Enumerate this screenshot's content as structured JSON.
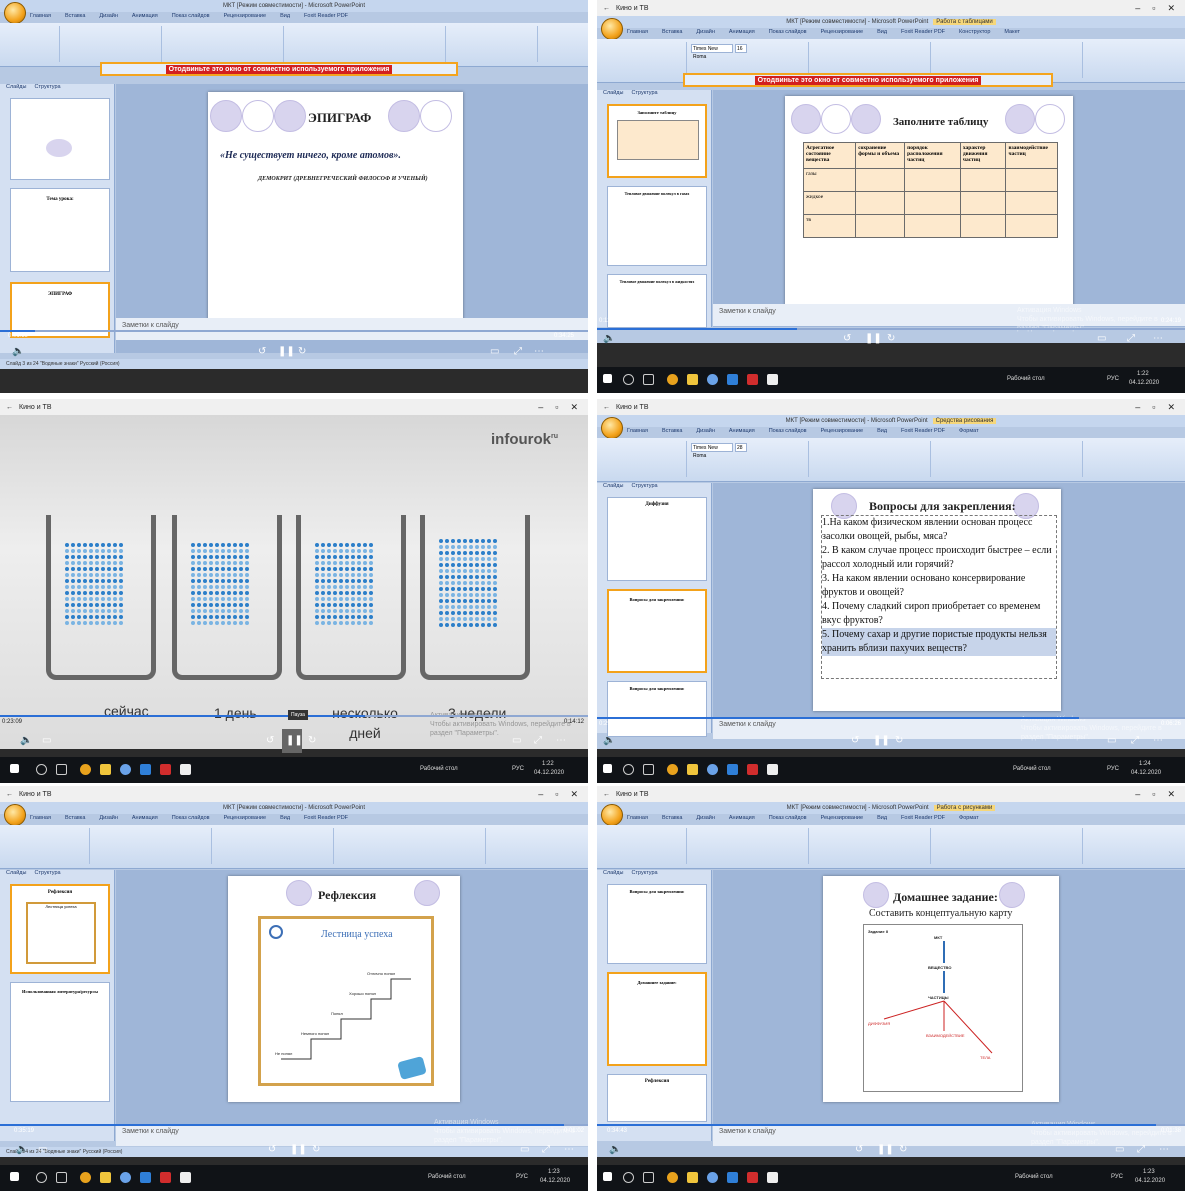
{
  "panels": {
    "p1": {
      "window_title": "МКТ [Режим совместимости] - Microsoft PowerPoint",
      "ribbon_tabs": [
        "Главная",
        "Вставка",
        "Дизайн",
        "Анимация",
        "Показ слайдов",
        "Рецензирование",
        "Вид",
        "Foxit Reader PDF"
      ],
      "warning": "Отодвиньте это окно от совместно используемого приложения",
      "pane_tabs": [
        "Слайды",
        "Структура"
      ],
      "thumb2_title": "Тема урока:",
      "thumb3_title": "ЭПИГРАФ",
      "slide_title": "ЭПИГРАФ",
      "quote": "«Не существует ничего, кроме атомов».",
      "author": "ДЕМОКРИТ (ДРЕВНЕГРЕЧЕСКИЙ ФИЛОСОФ И УЧЕНЫЙ)",
      "notes": "Заметки к слайду",
      "time_left": "0:01:59",
      "time_right": "0:34:25",
      "status": "Слайд 3 из 24   \"Водяные знаки\"   Русский (Россия)"
    },
    "p2": {
      "app_title": "Кино и ТВ",
      "window_title": "МКТ [Режим совместимости] - Microsoft PowerPoint",
      "context_tab": "Работа с таблицами",
      "ribbon_tabs": [
        "Главная",
        "Вставка",
        "Дизайн",
        "Анимация",
        "Показ слайдов",
        "Рецензирование",
        "Вид",
        "Foxit Reader PDF",
        "Конструктор",
        "Макет"
      ],
      "font_box": "Times New Roma",
      "size_box": "16",
      "warning": "Отодвиньте это окно от совместно используемого приложения",
      "pane_tabs": [
        "Слайды",
        "Структура"
      ],
      "thumb1_title": "Заполните таблицу",
      "thumb2_title": "Тепловое движение молекул в газах",
      "thumb3_title": "Тепловое движение молекул в жидкостях",
      "slide_title": "Заполните таблицу",
      "table_headers": [
        "Агрегатное состояние вещества",
        "сохранение формы и объема",
        "порядок расположения частиц",
        "характер движения частиц",
        "взаимодействие частиц"
      ],
      "table_rows": [
        "газы",
        "жидкое",
        "тв"
      ],
      "notes": "Заметки к слайду",
      "time_left": "0:12:02",
      "time_right": "0:24:19",
      "watermark": [
        "Активация Windows",
        "Чтобы активировать Windows, перейдите в",
        "раздел \"Параметры\"."
      ],
      "taskbar_text": "Рабочий стол",
      "taskbar_lang": "РУС",
      "clock_time": "1:22",
      "clock_date": "04.12.2020"
    },
    "p3": {
      "app_title": "Кино и ТВ",
      "brand": "infourok",
      "brand_sup": "ru",
      "labels": [
        "сейчас",
        "1 день",
        "несколько дней",
        "3 недели"
      ],
      "tooltip": "Пауза",
      "time_left": "0:23:09",
      "time_right": "0:14:12",
      "watermark": [
        "Активация Windows",
        "Чтобы активировать Windows, перейдите в",
        "раздел \"Параметры\"."
      ],
      "taskbar_text": "Рабочий стол",
      "taskbar_lang": "РУС",
      "clock_time": "1:22",
      "clock_date": "04.12.2020"
    },
    "p4": {
      "app_title": "Кино и ТВ",
      "window_title": "МКТ [Режим совместимости] - Microsoft PowerPoint",
      "context_tab": "Средства рисования",
      "ribbon_tabs": [
        "Главная",
        "Вставка",
        "Дизайн",
        "Анимация",
        "Показ слайдов",
        "Рецензирование",
        "Вид",
        "Foxit Reader PDF",
        "Формат"
      ],
      "font_box": "Times New Roma",
      "size_box": "28",
      "pane_tabs": [
        "Слайды",
        "Структура"
      ],
      "thumb1_title": "Диффузия",
      "thumb2_title": "Вопросы для закрепления:",
      "thumb3_title": "Вопросы для закрепления:",
      "slide_title": "Вопросы для закрепления:",
      "questions": [
        "1.На каком физическом явлении основан процесс засолки овощей, рыбы, мяса?",
        "2. В каком случае процесс происходит быстрее – если рассол холодный или горячий?",
        "3. На каком явлении основано консервирование фруктов и овощей?",
        "4. Почему сладкий сироп приобретает со временем вкус фруктов?",
        "5. Почему сахар и другие пористые продукты нельзя хранить вблизи пахучих веществ?"
      ],
      "notes": "Заметки к слайду",
      "time_left": "0:29:55",
      "time_right": "0:06:26",
      "watermark": [
        "Активация Windows",
        "Чтобы активировать Windows, перейдите в",
        "раздел \"Параметры\"."
      ],
      "taskbar_text": "Рабочий стол",
      "taskbar_lang": "РУС",
      "clock_time": "1:24",
      "clock_date": "04.12.2020"
    },
    "p5": {
      "app_title": "Кино и ТВ",
      "window_title": "МКТ [Режим совместимости] - Microsoft PowerPoint",
      "ribbon_tabs": [
        "Главная",
        "Вставка",
        "Дизайн",
        "Анимация",
        "Показ слайдов",
        "Рецензирование",
        "Вид",
        "Foxit Reader PDF"
      ],
      "pane_tabs": [
        "Слайды",
        "Структура"
      ],
      "thumb1_title": "Рефлексия",
      "thumb1_sub": "Лестница успеха",
      "thumb2_title": "Использованная литература/ресурсы",
      "slide_title": "Рефлексия",
      "ladder_title": "Лестница успеха",
      "steps": [
        "Отлично понял",
        "Хорошо понял",
        "Понял",
        "Немного понял",
        "Не понял"
      ],
      "notes": "Заметки к слайду",
      "time_left": "0:35:19",
      "time_right": "0:01:02",
      "watermark": [
        "Активация Windows",
        "Чтобы активировать Windows, перейдите в",
        "раздел \"Параметры\"."
      ],
      "status": "Слайд 24 из 24   \"Водяные знаки\"   Русский (Россия)",
      "taskbar_text": "Рабочий стол",
      "taskbar_lang": "РУС",
      "clock_time": "1:23",
      "clock_date": "04.12.2020"
    },
    "p6": {
      "app_title": "Кино и ТВ",
      "window_title": "МКТ [Режим совместимости] - Microsoft PowerPoint",
      "context_tab": "Работа с рисунками",
      "ribbon_tabs": [
        "Главная",
        "Вставка",
        "Дизайн",
        "Анимация",
        "Показ слайдов",
        "Рецензирование",
        "Вид",
        "Foxit Reader PDF",
        "Формат"
      ],
      "pane_tabs": [
        "Слайды",
        "Структура"
      ],
      "thumb1_title": "Вопросы для закрепления:",
      "thumb2_title": "Домашнее задание:",
      "thumb3_title": "Рефлексия",
      "slide_title": "Домашнее задание:",
      "slide_subtitle": "Составить концептуальную карту",
      "map_label": "Задание II",
      "map_nodes": [
        "МКТ",
        "ВЕЩЕСТВО",
        "ЧАСТИЦЫ",
        "ДИФФУЗИЯ",
        "ВЗАИМОДЕЙСТВИЕ",
        "ТЕЛА"
      ],
      "notes": "Заметки к слайду",
      "time_left": "0:34:43",
      "time_right": "0:01:38",
      "watermark": [
        "Активация Windows",
        "Чтобы активировать Windows, перейдите в",
        "раздел \"Параметры\"."
      ],
      "taskbar_text": "Рабочий стол",
      "taskbar_lang": "РУС",
      "clock_time": "1:23",
      "clock_date": "04.12.2020"
    }
  }
}
